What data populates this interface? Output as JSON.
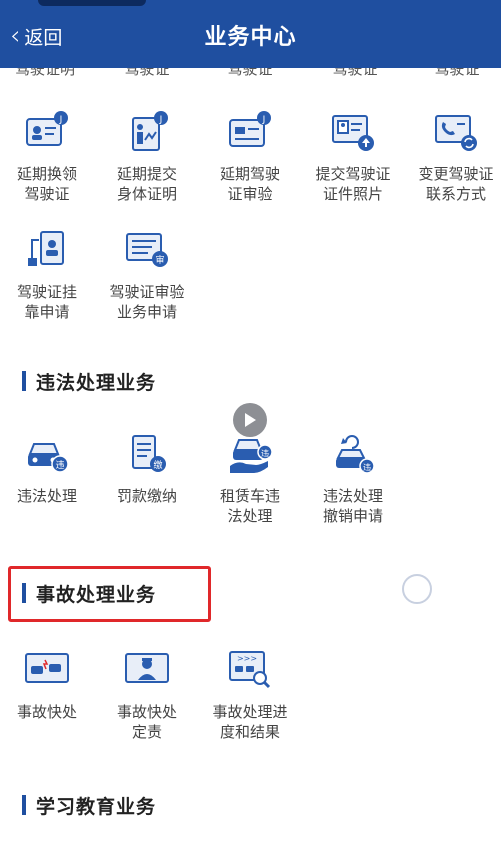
{
  "header": {
    "back_label": "返回",
    "title": "业务中心"
  },
  "cut_row": [
    "驾驶证明",
    "驾驶证",
    "驾驶证",
    "驾驶证",
    "驾驶证"
  ],
  "license_items": [
    {
      "label": "延期换领\n驾驶证",
      "icon": "license-renew-icon"
    },
    {
      "label": "延期提交\n身体证明",
      "icon": "health-cert-icon"
    },
    {
      "label": "延期驾驶\n证审验",
      "icon": "license-review-delay-icon"
    },
    {
      "label": "提交驾驶证\n证件照片",
      "icon": "photo-upload-icon"
    },
    {
      "label": "变更驾驶证\n联系方式",
      "icon": "contact-change-icon"
    },
    {
      "label": "驾驶证挂\n靠申请",
      "icon": "affiliation-icon"
    },
    {
      "label": "驾驶证审验\n业务申请",
      "icon": "license-review-icon"
    }
  ],
  "sections": {
    "violation": "违法处理业务",
    "accident": "事故处理业务",
    "study": "学习教育业务"
  },
  "violation_items": [
    {
      "label": "违法处理",
      "icon": "car-violation-icon"
    },
    {
      "label": "罚款缴纳",
      "icon": "fine-payment-icon"
    },
    {
      "label": "租赁车违\n法处理",
      "icon": "rental-car-icon"
    },
    {
      "label": "违法处理\n撤销申请",
      "icon": "violation-revoke-icon"
    }
  ],
  "accident_items": [
    {
      "label": "事故快处",
      "icon": "accident-quick-icon"
    },
    {
      "label": "事故快处\n定责",
      "icon": "accident-liability-icon"
    },
    {
      "label": "事故处理进\n度和结果",
      "icon": "accident-progress-icon"
    }
  ],
  "colors": {
    "brand": "#1f4fa0",
    "highlight": "#e0282a"
  }
}
